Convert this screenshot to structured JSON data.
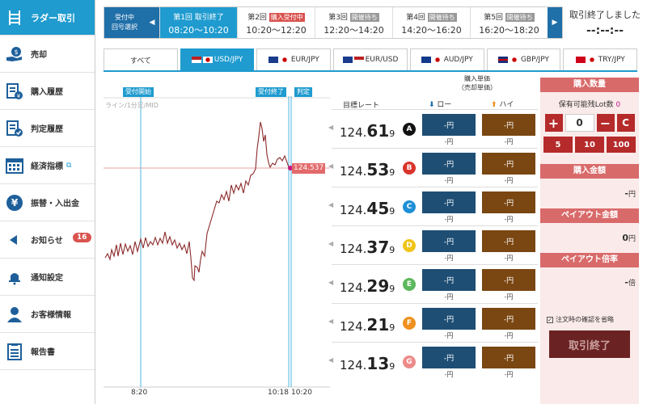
{
  "sidebar": {
    "items": [
      {
        "label": "ラダー取引",
        "icon": "ladder-icon"
      },
      {
        "label": "売却",
        "icon": "sell-icon"
      },
      {
        "label": "購入履歴",
        "icon": "purchase-history-icon"
      },
      {
        "label": "判定履歴",
        "icon": "judgement-history-icon"
      },
      {
        "label": "経済指標",
        "icon": "calendar-icon"
      },
      {
        "label": "振替・入出金",
        "icon": "yen-icon"
      },
      {
        "label": "お知らせ",
        "icon": "megaphone-icon",
        "badge": "16"
      },
      {
        "label": "通知設定",
        "icon": "bell-icon"
      },
      {
        "label": "お客様情報",
        "icon": "user-icon"
      },
      {
        "label": "報告書",
        "icon": "report-icon"
      }
    ]
  },
  "rounds": {
    "selector_line1": "受付中",
    "selector_line2": "回号選択",
    "items": [
      {
        "name": "第1回",
        "tag": "取引終了",
        "time": "08:20〜10:20"
      },
      {
        "name": "第2回",
        "tag": "購入受付中",
        "time": "10:20〜12:20"
      },
      {
        "name": "第3回",
        "tag": "開催待ち",
        "time": "12:20〜14:20"
      },
      {
        "name": "第4回",
        "tag": "開催待ち",
        "time": "14:20〜16:20"
      },
      {
        "name": "第5回",
        "tag": "開催待ち",
        "time": "16:20〜18:20"
      }
    ]
  },
  "status": {
    "line1": "取引終了しました",
    "line2": "--:--:--"
  },
  "currency_tabs": [
    "すべて",
    "USD/JPY",
    "EUR/JPY",
    "EUR/USD",
    "AUD/JPY",
    "GBP/JPY",
    "TRY/JPY"
  ],
  "chart": {
    "tag_start": "受付開始",
    "tag_end": "受付終了",
    "tag_judge": "判定",
    "subtitle": "ライン/1分足/MID",
    "current_label": "124.537",
    "x_labels": [
      "8:20",
      "10:18",
      "10:20"
    ]
  },
  "table": {
    "rate_header": "目標レート",
    "unit_header_1": "購入単価",
    "unit_header_2": "（売却単価）",
    "low_header": "ロー",
    "high_header": "ハイ",
    "rows": [
      {
        "pre": "124.",
        "big": "61",
        "post": "9",
        "letter": "A",
        "color": "#111111",
        "low": "-円",
        "low_sub": "-円",
        "high": "-円",
        "high_sub": "-円"
      },
      {
        "pre": "124.",
        "big": "53",
        "post": "9",
        "letter": "B",
        "color": "#d9342b",
        "low": "-円",
        "low_sub": "-円",
        "high": "-円",
        "high_sub": "-円"
      },
      {
        "pre": "124.",
        "big": "45",
        "post": "9",
        "letter": "C",
        "color": "#1f8fd6",
        "low": "-円",
        "low_sub": "-円",
        "high": "-円",
        "high_sub": "-円"
      },
      {
        "pre": "124.",
        "big": "37",
        "post": "9",
        "letter": "D",
        "color": "#f0c419",
        "low": "-円",
        "low_sub": "-円",
        "high": "-円",
        "high_sub": "-円"
      },
      {
        "pre": "124.",
        "big": "29",
        "post": "9",
        "letter": "E",
        "color": "#5cb85c",
        "low": "-円",
        "low_sub": "-円",
        "high": "-円",
        "high_sub": "-円"
      },
      {
        "pre": "124.",
        "big": "21",
        "post": "9",
        "letter": "F",
        "color": "#f0901e",
        "low": "-円",
        "low_sub": "-円",
        "high": "-円",
        "high_sub": "-円"
      },
      {
        "pre": "124.",
        "big": "13",
        "post": "9",
        "letter": "G",
        "color": "#ee8a8a",
        "low": "-円",
        "low_sub": "-円",
        "high": "-円",
        "high_sub": "-円"
      }
    ]
  },
  "panel": {
    "qty_header": "購入数量",
    "lot_label": "保有可能残Lot数",
    "lot_value": "0",
    "qty_value": "0",
    "plus": "+",
    "minus": "−",
    "clear": "C",
    "lots": [
      "5",
      "10",
      "100"
    ],
    "amount_header": "購入金額",
    "amount_value": "-",
    "amount_unit": "円",
    "payout_header": "ペイアウト金額",
    "payout_value": "0",
    "payout_unit": "円",
    "ratio_header": "ペイアウト倍率",
    "ratio_value": "-",
    "ratio_unit": "倍",
    "skip_confirm": "注文時の確認を省略",
    "end_button": "取引終了"
  }
}
